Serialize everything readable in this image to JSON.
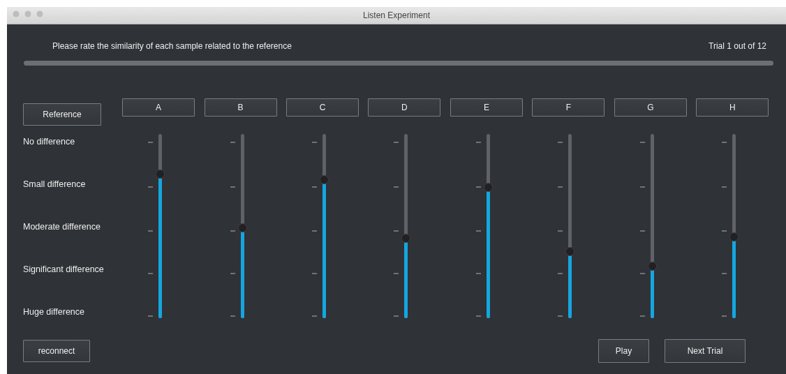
{
  "window": {
    "title": "Listen Experiment"
  },
  "instruction": "Please rate the similarity of each sample related to the reference",
  "trial": "Trial 1 out of 12",
  "progress": {
    "level": 0
  },
  "reference_button": "Reference",
  "scale_labels": [
    "No difference",
    "Small difference",
    "Moderate difference",
    "Significant difference",
    "Huge difference"
  ],
  "samples": [
    {
      "label": "A",
      "level": 0.78
    },
    {
      "label": "B",
      "level": 0.49
    },
    {
      "label": "C",
      "level": 0.75
    },
    {
      "label": "D",
      "level": 0.43
    },
    {
      "label": "E",
      "level": 0.71
    },
    {
      "label": "F",
      "level": 0.36
    },
    {
      "label": "G",
      "level": 0.28
    },
    {
      "label": "H",
      "level": 0.44
    }
  ],
  "buttons": {
    "reconnect": "reconnect",
    "play": "Play",
    "next": "Next Trial"
  }
}
